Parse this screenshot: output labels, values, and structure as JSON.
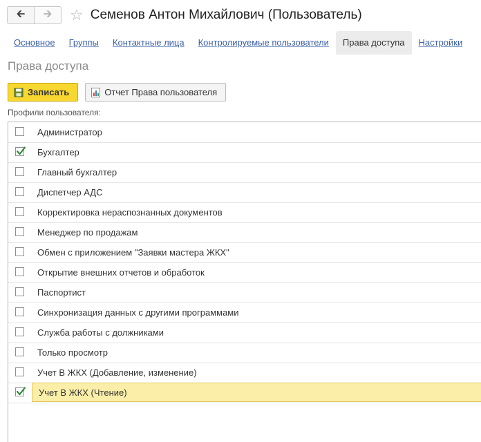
{
  "window": {
    "title": "Семенов Антон Михайлович (Пользователь)",
    "back_icon": "arrow-left-icon",
    "forward_icon": "arrow-right-icon",
    "favorite_icon": "star-icon"
  },
  "tabs": [
    {
      "label": "Основное",
      "active": false
    },
    {
      "label": "Группы",
      "active": false
    },
    {
      "label": "Контактные лица",
      "active": false
    },
    {
      "label": "Контролируемые пользователи",
      "active": false
    },
    {
      "label": "Права доступа",
      "active": true
    },
    {
      "label": "Настройки",
      "active": false
    }
  ],
  "section_title": "Права доступа",
  "toolbar": {
    "save_label": "Записать",
    "report_label": "Отчет Права пользователя",
    "report_icon": "report-icon"
  },
  "profiles": {
    "label": "Профили пользователя:",
    "items": [
      {
        "label": "Администратор",
        "checked": false
      },
      {
        "label": "Бухгалтер",
        "checked": true
      },
      {
        "label": "Главный бухгалтер",
        "checked": false
      },
      {
        "label": "Диспетчер АДС",
        "checked": false
      },
      {
        "label": "Корректировка нераспознанных документов",
        "checked": false
      },
      {
        "label": "Менеджер по продажам",
        "checked": false
      },
      {
        "label": "Обмен с приложением \"Заявки мастера ЖКХ\"",
        "checked": false
      },
      {
        "label": "Открытие внешних отчетов и обработок",
        "checked": false
      },
      {
        "label": "Паспортист",
        "checked": false
      },
      {
        "label": "Синхронизация данных с другими программами",
        "checked": false
      },
      {
        "label": "Служба работы с должниками",
        "checked": false
      },
      {
        "label": "Только просмотр",
        "checked": false
      },
      {
        "label": "Учет В ЖКХ (Добавление, изменение)",
        "checked": false
      },
      {
        "label": "Учет В ЖКХ (Чтение)",
        "checked": true,
        "selected": true
      }
    ]
  },
  "colors": {
    "accent_yellow": "#f8d830",
    "link_blue": "#3b5fa5",
    "check_green": "#2e8b3a",
    "selection": "#fbeea8"
  }
}
